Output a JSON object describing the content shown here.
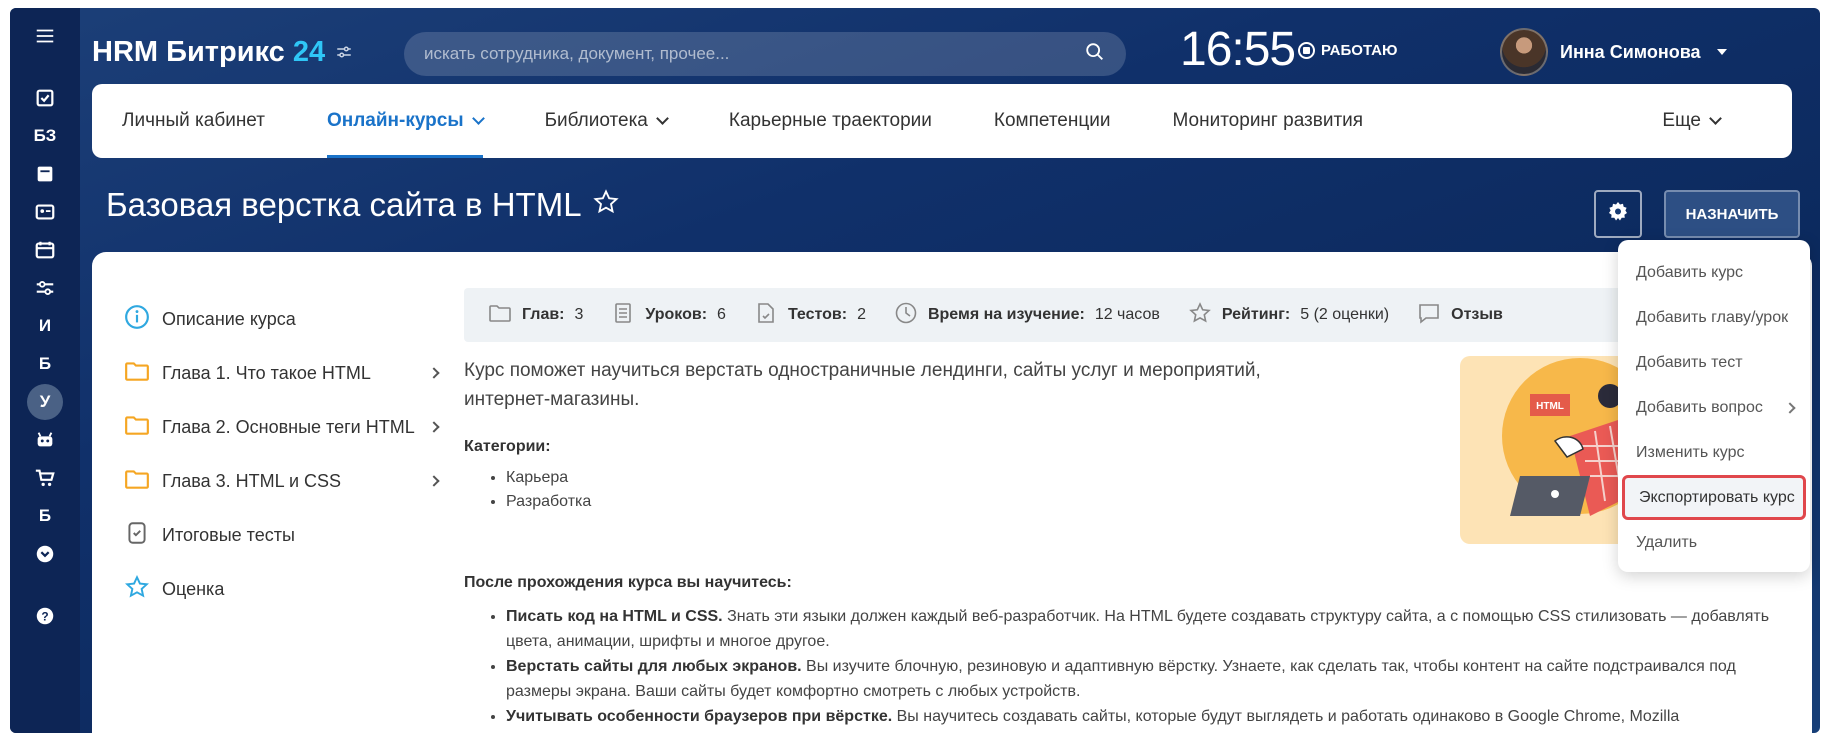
{
  "app": {
    "logo_text": "HRM Битрикс",
    "logo_num": "24"
  },
  "search": {
    "placeholder": "искать сотрудника, документ, прочее..."
  },
  "clock": "16:55",
  "work_status": "РАБОТАЮ",
  "user": {
    "name": "Инна Симонова"
  },
  "rail": {
    "items": [
      {
        "type": "icon",
        "name": "tasks-icon"
      },
      {
        "type": "text",
        "label": "БЗ"
      },
      {
        "type": "icon",
        "name": "feed-icon"
      },
      {
        "type": "icon",
        "name": "contact-card-icon"
      },
      {
        "type": "icon",
        "name": "calendar-icon"
      },
      {
        "type": "icon",
        "name": "sliders-icon"
      },
      {
        "type": "text",
        "label": "И"
      },
      {
        "type": "text",
        "label": "Б"
      },
      {
        "type": "text",
        "label": "У",
        "active": true
      },
      {
        "type": "icon",
        "name": "robot-icon"
      },
      {
        "type": "icon",
        "name": "cart-icon"
      },
      {
        "type": "text",
        "label": "Б"
      },
      {
        "type": "icon",
        "name": "more-down-icon"
      },
      {
        "type": "icon",
        "name": "help-icon"
      }
    ]
  },
  "topnav": {
    "items": [
      {
        "label": "Личный кабинет"
      },
      {
        "label": "Онлайн-курсы"
      },
      {
        "label": "Библиотека"
      },
      {
        "label": "Карьерные траектории"
      },
      {
        "label": "Компетенции"
      },
      {
        "label": "Мониторинг развития"
      }
    ],
    "more": "Еще"
  },
  "page": {
    "title": "Базовая верстка сайта в HTML",
    "assign_button": "НАЗНАЧИТЬ"
  },
  "sidebar": {
    "items": [
      {
        "label": "Описание курса"
      },
      {
        "label": "Глава 1. Что такое HTML"
      },
      {
        "label": "Глава 2. Основные теги HTML"
      },
      {
        "label": "Глава 3. HTML и CSS"
      },
      {
        "label": "Итоговые тесты"
      },
      {
        "label": "Оценка"
      }
    ]
  },
  "stats": {
    "chapters_label": "Глав:",
    "chapters_value": "3",
    "lessons_label": "Уроков:",
    "lessons_value": "6",
    "tests_label": "Тестов:",
    "tests_value": "2",
    "time_label": "Время на изучение:",
    "time_value": "12 часов",
    "rating_label": "Рейтинг:",
    "rating_value": "5 (2 оценки)",
    "reviews_label": "Отзыв"
  },
  "description": "Курс поможет научиться верстать одностраничные лендинги, сайты услуг и мероприятий, интернет-магазины.",
  "categories": {
    "title": "Категории:",
    "items": [
      "Карьера",
      "Разработка"
    ]
  },
  "learn": {
    "title": "После прохождения курса вы научитесь:",
    "items": [
      {
        "bold": "Писать код на HTML и CSS.",
        "text": " Знать эти языки должен каждый веб-разработчик. На HTML будете создавать структуру сайта, а с помощью CSS стилизовать — добавлять цвета, анимации, шрифты и многое другое."
      },
      {
        "bold": "Верстать сайты для любых экранов.",
        "text": " Вы изучите блочную, резиновую и адаптивную вёрстку. Узнаете, как сделать так, чтобы контент на сайте подстраивался под размеры экрана. Ваши сайты будет комфортно смотреть с любых устройств."
      },
      {
        "bold": "Учитывать особенности браузеров при вёрстке.",
        "text": " Вы научитесь создавать сайты, которые будут выглядеть и работать одинаково в Google Chrome, Mozilla"
      }
    ]
  },
  "illustration": {
    "badge": "HTML"
  },
  "menu": {
    "items": [
      {
        "label": "Добавить курс"
      },
      {
        "label": "Добавить главу/урок"
      },
      {
        "label": "Добавить тест"
      },
      {
        "label": "Добавить вопрос"
      },
      {
        "label": "Изменить курс"
      },
      {
        "label": "Экспортировать курс"
      },
      {
        "label": "Удалить"
      }
    ]
  },
  "colors": {
    "accent": "#1a73c9",
    "logo_accent": "#2fc6f6",
    "highlight_border": "#e0474c",
    "folder": "#f5a623",
    "info": "#2fa8e0"
  }
}
